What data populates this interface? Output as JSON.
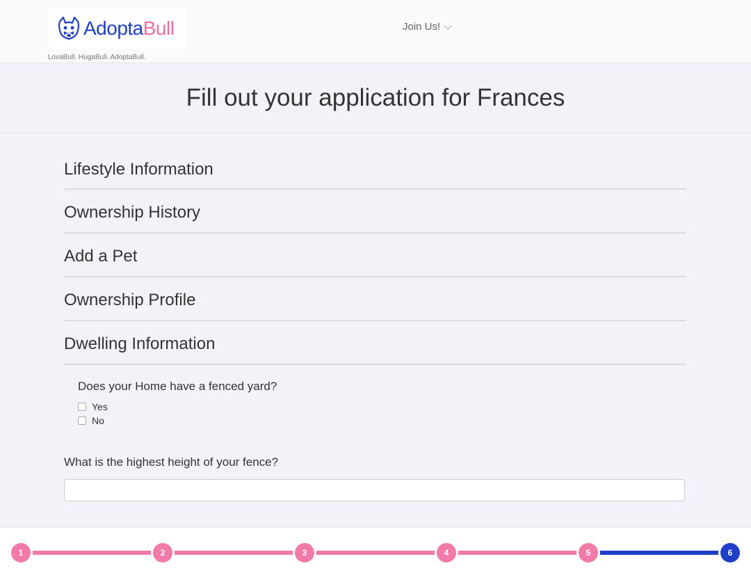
{
  "header": {
    "logo": {
      "part1": "Adopta",
      "part2": "Bull"
    },
    "tagline": "LovaBull. HugaBull. AdoptaBull.",
    "nav_join": "Join Us!"
  },
  "page": {
    "title": "Fill out your application for Frances"
  },
  "sections": [
    {
      "label": "Lifestyle Information"
    },
    {
      "label": "Ownership History"
    },
    {
      "label": "Add a Pet"
    },
    {
      "label": "Ownership Profile"
    },
    {
      "label": "Dwelling Information"
    }
  ],
  "dwelling": {
    "fenced_question": "Does your Home have a fenced yard?",
    "options": [
      "Yes",
      "No"
    ],
    "fence_height_question": "What is the highest height of your fence?",
    "fence_height_value": ""
  },
  "progress": {
    "steps": [
      "1",
      "2",
      "3",
      "4",
      "5",
      "6"
    ],
    "current_step": 6,
    "colors": {
      "done": "#f27aa8",
      "current": "#1f3fc8"
    }
  },
  "colors": {
    "brand_blue": "#1f3fc8",
    "brand_pink": "#ec6fa4"
  },
  "icons": {
    "logo": "bulldog-head-icon",
    "nav_dropdown": "chevron-down-icon"
  }
}
